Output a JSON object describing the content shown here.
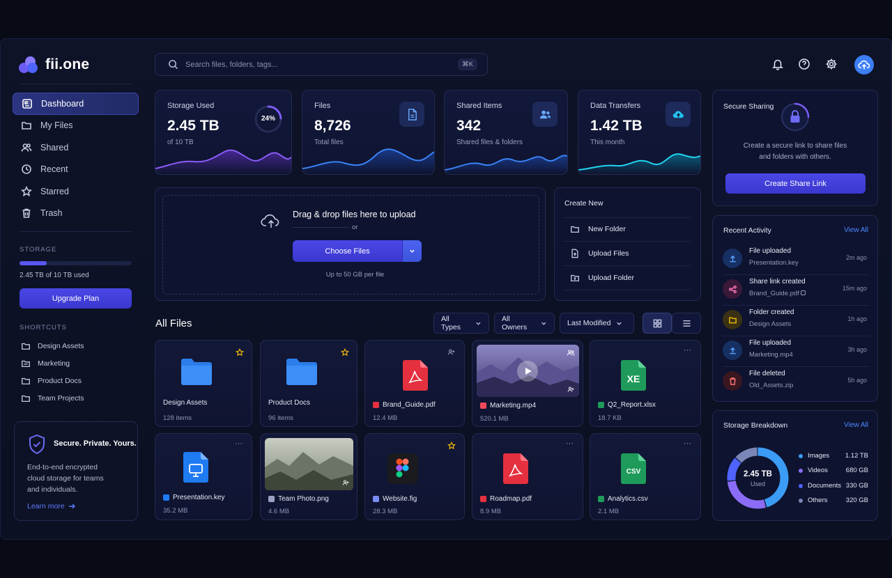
{
  "app": {
    "name": "fii.one"
  },
  "search": {
    "placeholder": "Search files, folders, tags...",
    "shortcut": "⌘K"
  },
  "icons": {
    "notifications": "bell-icon",
    "help": "help-icon",
    "settings": "gear-icon",
    "upload_avatar": "cloud-upload-icon"
  },
  "sidebar": {
    "nav": [
      {
        "label": "Dashboard",
        "icon": "dashboard-icon",
        "active": true
      },
      {
        "label": "My Files",
        "icon": "folder-icon"
      },
      {
        "label": "Shared",
        "icon": "users-icon"
      },
      {
        "label": "Recent",
        "icon": "clock-icon"
      },
      {
        "label": "Starred",
        "icon": "star-icon"
      },
      {
        "label": "Trash",
        "icon": "trash-icon"
      }
    ],
    "storage": {
      "heading": "STORAGE",
      "used_fraction": 0.245,
      "text": "2.45 TB of 10 TB used",
      "button": "Upgrade Plan"
    },
    "shortcuts": {
      "heading": "SHORTCUTS",
      "items": [
        "Design Assets",
        "Marketing",
        "Product Docs",
        "Team Projects"
      ]
    },
    "secure": {
      "title": "Secure. Private. Yours.",
      "text_lines": [
        "End-to-end encrypted",
        "cloud storage for teams",
        "and individuals."
      ],
      "link": "Learn more"
    }
  },
  "stats": [
    {
      "label": "Storage Used",
      "value": "2.45 TB",
      "sub": "of 10 TB",
      "ring": "24%",
      "ring_fraction": 0.24
    },
    {
      "label": "Files",
      "value": "8,726",
      "sub": "Total files",
      "icon": "document-icon"
    },
    {
      "label": "Shared Items",
      "value": "342",
      "sub": "Shared files & folders",
      "icon": "users-icon"
    },
    {
      "label": "Data Transfers",
      "value": "1.42 TB",
      "sub": "This month",
      "icon": "cloud-upload-icon"
    }
  ],
  "upload": {
    "title": "Drag & drop files here to upload",
    "or": "or",
    "button": "Choose Files",
    "hint": "Up to 50 GB per file"
  },
  "create_new": {
    "title": "Create New",
    "items": [
      "New Folder",
      "Upload Files",
      "Upload Folder"
    ]
  },
  "all_files": {
    "title": "All Files",
    "filters": [
      "All Types",
      "All Owners",
      "Last Modified"
    ],
    "files": [
      {
        "name": "Design Assets",
        "meta": "128 items",
        "kind": "folder",
        "mark": "star"
      },
      {
        "name": "Product Docs",
        "meta": "96 items",
        "kind": "folder",
        "mark": "star"
      },
      {
        "name": "Brand_Guide.pdf",
        "meta": "12.4 MB",
        "kind": "pdf",
        "mark": "shared"
      },
      {
        "name": "Marketing.mp4",
        "meta": "520.1 MB",
        "kind": "video",
        "mark": "shared"
      },
      {
        "name": "Q2_Report.xlsx",
        "meta": "18.7 KB",
        "kind": "xlsx",
        "mark": "more"
      },
      {
        "name": "Presentation.key",
        "meta": "35.2 MB",
        "kind": "key",
        "mark": "more"
      },
      {
        "name": "Team Photo.png",
        "meta": "4.6 MB",
        "kind": "image",
        "mark": "none"
      },
      {
        "name": "Website.fig",
        "meta": "28.3 MB",
        "kind": "fig",
        "mark": "star"
      },
      {
        "name": "Roadmap.pdf",
        "meta": "8.9 MB",
        "kind": "pdf",
        "mark": "more"
      },
      {
        "name": "Analytics.csv",
        "meta": "2.1 MB",
        "kind": "csv",
        "mark": "more"
      }
    ],
    "more_glyph": "···",
    "xlsx_label": "XE",
    "csv_label": "CSV"
  },
  "secure_sharing": {
    "title": "Secure Sharing",
    "text_lines": [
      "Create a secure link to share files",
      "and folders with others."
    ],
    "button": "Create Share Link"
  },
  "recent_activity": {
    "title": "Recent Activity",
    "view_all": "View All",
    "items": [
      {
        "title": "File uploaded",
        "sub": "Presentation.key",
        "time": "2m ago",
        "color": "#3b82f6",
        "icon": "upload-icon"
      },
      {
        "title": "Share link created",
        "sub": "Brand_Guide.pdf",
        "time": "15m ago",
        "color": "#ec4899",
        "icon": "share-icon"
      },
      {
        "title": "Folder created",
        "sub": "Design Assets",
        "time": "1h ago",
        "color": "#eab308",
        "icon": "folder-icon"
      },
      {
        "title": "File uploaded",
        "sub": "Marketing.mp4",
        "time": "3h ago",
        "color": "#3b82f6",
        "icon": "upload-icon"
      },
      {
        "title": "File deleted",
        "sub": "Old_Assets.zip",
        "time": "5h ago",
        "color": "#ef4444",
        "icon": "trash-icon"
      }
    ]
  },
  "storage_breakdown": {
    "title": "Storage Breakdown",
    "view_all": "View All",
    "center_value": "2.45 TB",
    "center_label": "Used",
    "legend": [
      {
        "name": "Images",
        "value": "1.12 TB",
        "color": "#3b9cf5"
      },
      {
        "name": "Videos",
        "value": "680 GB",
        "color": "#8b6cf6"
      },
      {
        "name": "Documents",
        "value": "330 GB",
        "color": "#4f63ff"
      },
      {
        "name": "Others",
        "value": "320 GB",
        "color": "#7b86b8"
      }
    ]
  },
  "colors": {
    "accent": "#4a47e6",
    "brand_blue": "#4d8bff"
  }
}
